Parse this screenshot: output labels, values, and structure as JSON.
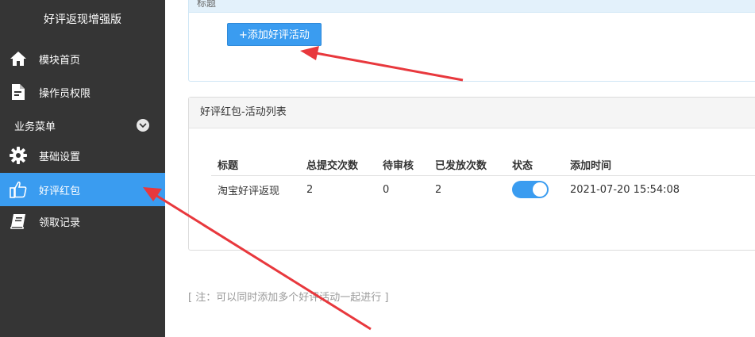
{
  "sidebar": {
    "title": "好评返现增强版",
    "items": [
      {
        "label": "模块首页",
        "icon": "home-icon"
      },
      {
        "label": "操作员权限",
        "icon": "document-icon"
      }
    ],
    "group": {
      "label": "业务菜单",
      "icon": "chevron-down-icon"
    },
    "group_items": [
      {
        "label": "基础设置",
        "icon": "gear-icon"
      },
      {
        "label": "好评红包",
        "icon": "thumbs-up-icon",
        "active": true
      },
      {
        "label": "领取记录",
        "icon": "book-icon"
      }
    ]
  },
  "top_panel": {
    "header": "标题",
    "add_button_label": "+添加好评活动"
  },
  "list_panel": {
    "title": "好评红包-活动列表",
    "columns": [
      "标题",
      "总提交次数",
      "待审核",
      "已发放次数",
      "状态",
      "添加时间"
    ],
    "rows": [
      {
        "title": "淘宝好评返现",
        "total": "2",
        "pending": "0",
        "issued": "2",
        "status_on": true,
        "added": "2021-07-20 15:54:08"
      }
    ]
  },
  "note": "[ 注：可以同时添加多个好评活动一起进行 ]",
  "colors": {
    "sidebar_bg": "#353535",
    "accent": "#3a9cf0",
    "annotation_arrow": "#e8383d"
  }
}
